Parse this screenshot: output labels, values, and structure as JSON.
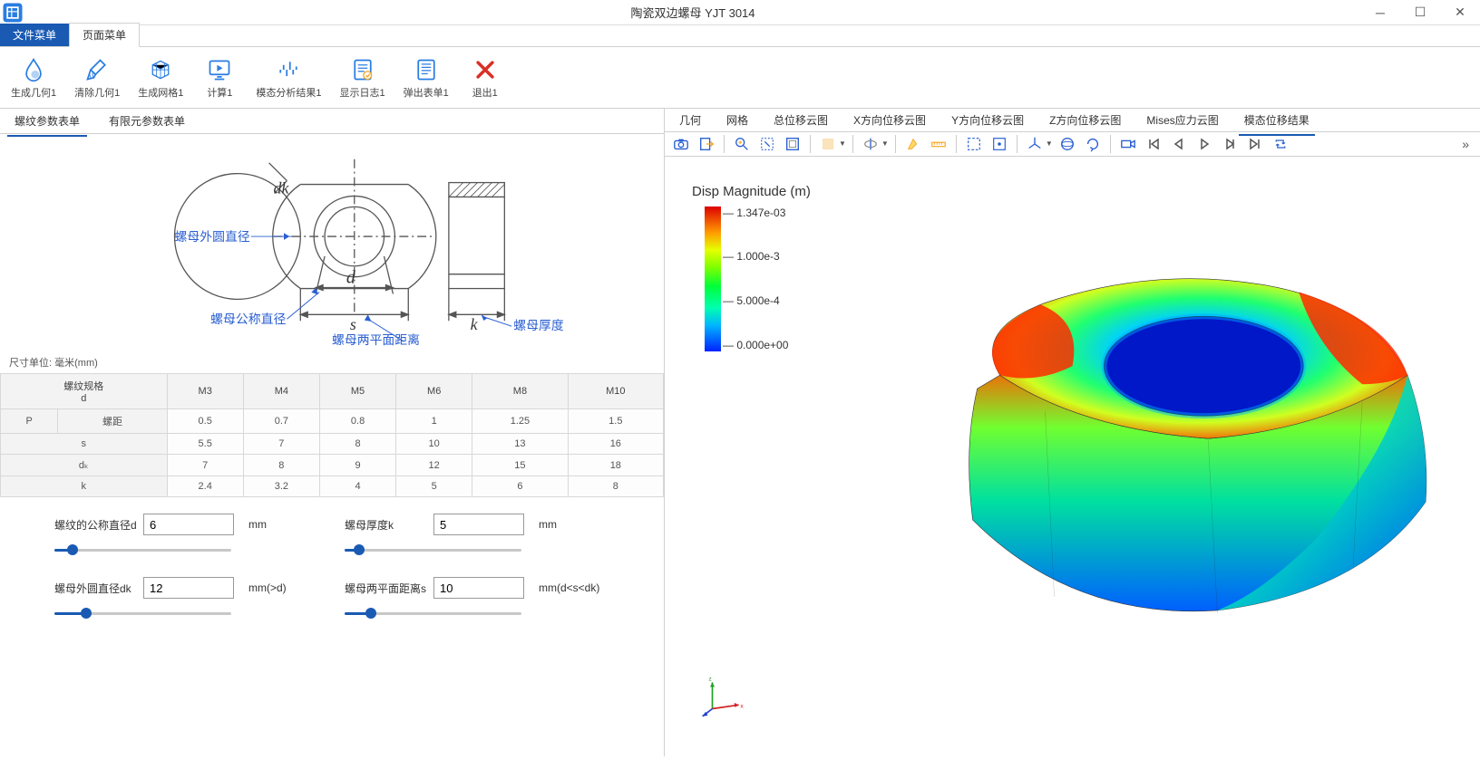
{
  "window": {
    "title": "陶瓷双边螺母 YJT 3014"
  },
  "menu_tabs": {
    "file": "文件菜单",
    "page": "页面菜单"
  },
  "ribbon": [
    {
      "id": "gen-geom",
      "label": "生成几何1"
    },
    {
      "id": "clear-geom",
      "label": "清除几何1"
    },
    {
      "id": "gen-mesh",
      "label": "生成网格1"
    },
    {
      "id": "compute",
      "label": "计算1"
    },
    {
      "id": "modal-result",
      "label": "模态分析结果1"
    },
    {
      "id": "show-log",
      "label": "显示日志1"
    },
    {
      "id": "popup-form",
      "label": "弹出表单1"
    },
    {
      "id": "exit",
      "label": "退出1"
    }
  ],
  "left_tabs": {
    "thread_params": "螺纹参数表单",
    "fem_params": "有限元参数表单"
  },
  "diagram_labels": {
    "dk": "dk",
    "d": "d",
    "s": "s",
    "k": "k",
    "outer_dia": "螺母外圆直径",
    "nominal_dia": "螺母公称直径",
    "two_plane_dist": "螺母两平面距离",
    "thickness": "螺母厚度"
  },
  "table": {
    "caption": "尺寸单位: 毫米(mm)",
    "head_spec": "螺纹规格",
    "head_spec_d": "d",
    "cols": [
      "M3",
      "M4",
      "M5",
      "M6",
      "M8",
      "M10"
    ],
    "row_p_sym": "P",
    "row_p_label": "螺距",
    "row_p": [
      "0.5",
      "0.7",
      "0.8",
      "1",
      "1.25",
      "1.5"
    ],
    "row_s_label": "s",
    "row_s": [
      "5.5",
      "7",
      "8",
      "10",
      "13",
      "16"
    ],
    "row_dk_label": "dₖ",
    "row_dk": [
      "7",
      "8",
      "9",
      "12",
      "15",
      "18"
    ],
    "row_k_label": "k",
    "row_k": [
      "2.4",
      "3.2",
      "4",
      "5",
      "6",
      "8"
    ]
  },
  "inputs": {
    "d": {
      "label": "螺纹的公称直径d",
      "value": "6",
      "unit": "mm",
      "pct": 10
    },
    "k": {
      "label": "螺母厚度k",
      "value": "5",
      "unit": "mm",
      "pct": 8
    },
    "dk": {
      "label": "螺母外圆直径dk",
      "value": "12",
      "unit": "mm(>d)",
      "pct": 18
    },
    "s": {
      "label": "螺母两平面距离s",
      "value": "10",
      "unit": "mm(d<s<dk)",
      "pct": 15
    }
  },
  "right_tabs": {
    "geom": "几何",
    "mesh": "网格",
    "total_disp": "总位移云图",
    "x_disp": "X方向位移云图",
    "y_disp": "Y方向位移云图",
    "z_disp": "Z方向位移云图",
    "mises": "Mises应力云图",
    "modal_disp": "模态位移结果"
  },
  "legend": {
    "title": "Disp Magnitude (m)",
    "labels": [
      "1.347e-03",
      "1.000e-3",
      "5.000e-4",
      "0.000e+00"
    ]
  }
}
